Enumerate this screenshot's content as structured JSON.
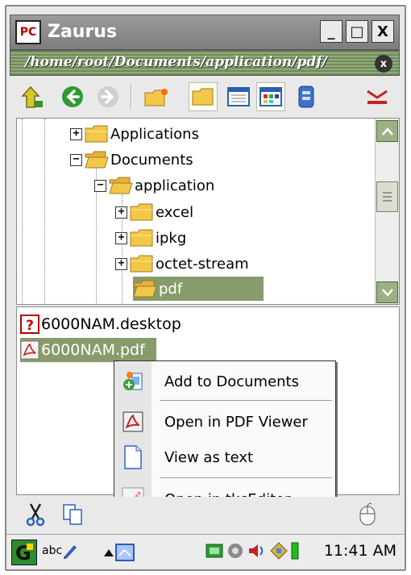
{
  "window": {
    "title": "Zaurus",
    "app_icon_text": "PC",
    "minimize_label": "_",
    "maximize_label": "□",
    "close_label": "X"
  },
  "pathbar": {
    "path": "/home/root/Documents/application/pdf/",
    "close_label": "x"
  },
  "toolbar": {
    "icons": [
      "up-arrow-icon",
      "back-icon",
      "forward-icon",
      "new-folder-icon",
      "folder-view-icon",
      "list-view-icon",
      "icon-view-icon",
      "storage-icon",
      "eject-icon"
    ]
  },
  "tree": {
    "items": [
      {
        "label": "Applications",
        "expander": "+"
      },
      {
        "label": "Documents",
        "expander": "−"
      },
      {
        "label": "application",
        "expander": "−"
      },
      {
        "label": "excel",
        "expander": "+"
      },
      {
        "label": "ipkg",
        "expander": "+"
      },
      {
        "label": "octet-stream",
        "expander": "+"
      },
      {
        "label": "pdf",
        "expander": ""
      }
    ],
    "selected": "pdf"
  },
  "files": [
    {
      "name": "6000NAM.desktop",
      "icon": "unknown-file-icon"
    },
    {
      "name": "6000NAM.pdf",
      "icon": "pdf-file-icon"
    }
  ],
  "context_menu": {
    "items": [
      {
        "label": "Add to Documents",
        "icon": "add-document-icon"
      },
      {
        "label": "Open in PDF Viewer",
        "icon": "pdf-viewer-icon"
      },
      {
        "label": "View as text",
        "icon": "text-document-icon"
      },
      {
        "label": "Open in tkcEditor",
        "icon": "pen-icon"
      }
    ]
  },
  "taskbar": {
    "input_mode": "abc",
    "clock": "11:41 AM"
  },
  "colors": {
    "selection": "#889b6c",
    "scroll_button": "#9cb083",
    "pathbar": "#7d9466"
  }
}
